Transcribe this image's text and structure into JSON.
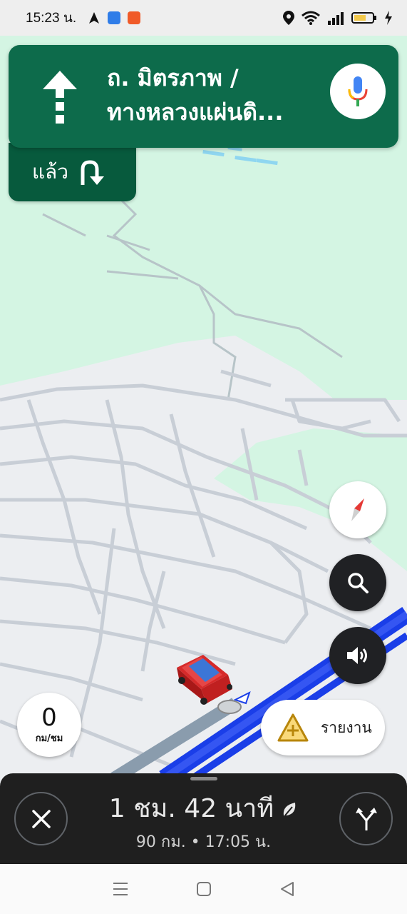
{
  "status_bar": {
    "time": "15:23 น.",
    "battery_color": "#f2c94c"
  },
  "direction": {
    "street_line1": "ถ. มิตรภาพ /",
    "street_line2": "ทางหลวงแผ่นดิ...",
    "then_label": "แล้ว",
    "maneuver_icon": "arrow-straight-icon",
    "next_maneuver_icon": "turn-right-icon",
    "card_color": "#0d6b4b"
  },
  "map": {
    "route_color": "#1a3ee8",
    "land_color": "#d4f5e3"
  },
  "controls": {
    "report_label": "รายงาน",
    "speed_value": "0",
    "speed_unit": "กม/ชม"
  },
  "trip": {
    "duration": "1 ชม. 42 นาที",
    "details": "90 กม. • 17:05 น."
  }
}
